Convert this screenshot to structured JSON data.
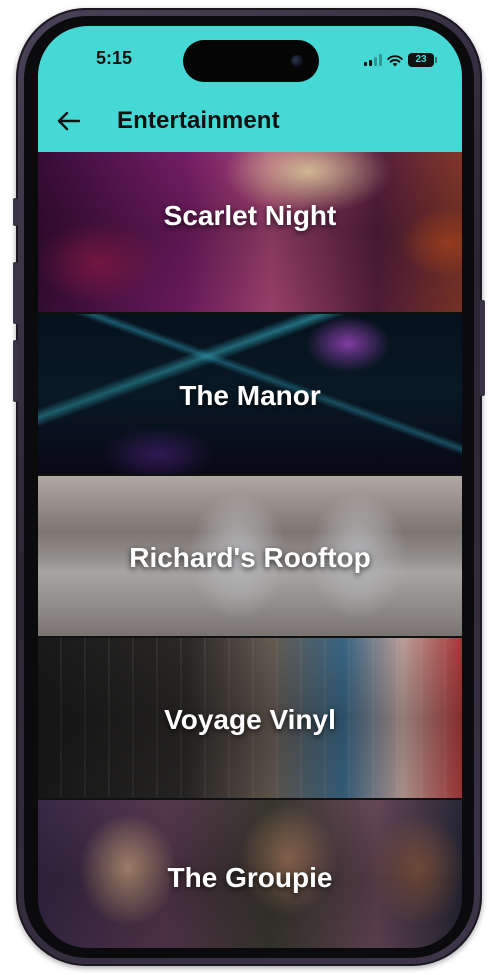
{
  "status_bar": {
    "time": "5:15",
    "battery_level": "23",
    "battery_fraction": 0.23,
    "icons": [
      "signal-icon",
      "wifi-icon",
      "battery-icon"
    ]
  },
  "app_bar": {
    "title": "Entertainment",
    "back_icon": "arrow-left-icon"
  },
  "theme": {
    "header_color": "#46d8d4",
    "venue_text_color": "#ffffff"
  },
  "venues": [
    {
      "name": "Scarlet Night"
    },
    {
      "name": "The Manor"
    },
    {
      "name": "Richard's Rooftop"
    },
    {
      "name": "Voyage Vinyl"
    },
    {
      "name": "The Groupie"
    }
  ]
}
